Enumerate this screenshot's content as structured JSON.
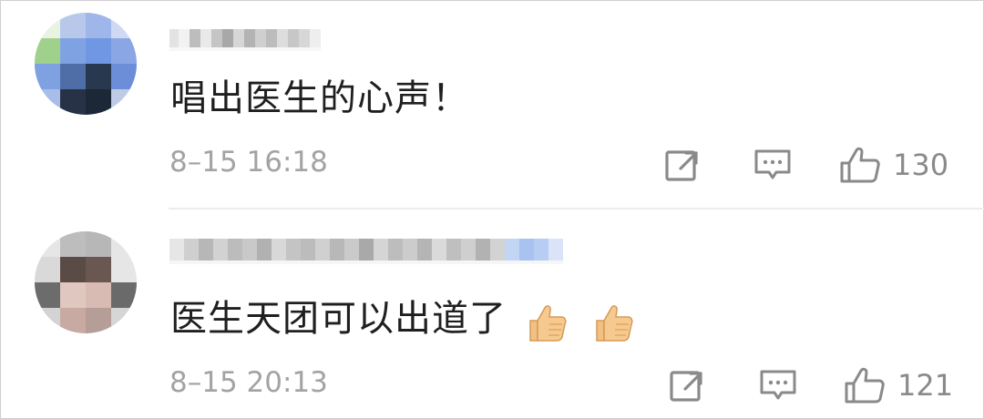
{
  "comments": [
    {
      "text": "唱出医生的心声！",
      "time": "8–15 16:18",
      "likes": "130"
    },
    {
      "text": "医生天团可以出道了",
      "time": "8–15 20:13",
      "likes": "121",
      "emojis": [
        "thumbs-up-icon",
        "thumbs-up-icon"
      ]
    }
  ],
  "colors": {
    "text": "#1f1f1f",
    "meta": "#a3a3a3",
    "icon": "#8a8a8a",
    "divider": "#ececec"
  }
}
